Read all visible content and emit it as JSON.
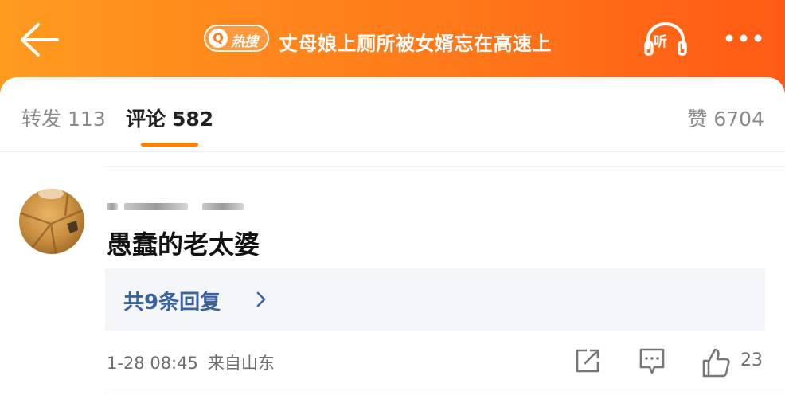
{
  "header": {
    "back_icon": "arrow-left-icon",
    "hot_badge_icon": "search-q-icon",
    "hot_badge_q": "Q",
    "hot_badge_label": "热搜",
    "title": "丈母娘上厕所被女婿忘在高速上",
    "listen_label": "听",
    "listen_icon": "headphones-icon",
    "more_icon": "more-dots-icon",
    "gradient": [
      "#ff9b1f",
      "#ff5a14"
    ]
  },
  "tabs": {
    "repost": {
      "label": "转发",
      "count": "113"
    },
    "comment": {
      "label": "评论",
      "count": "582",
      "active": true
    },
    "like": {
      "label": "赞",
      "count": "6704"
    },
    "accent_color": "#ff8200"
  },
  "comment": {
    "avatar_icon": "avatar-image",
    "text": "愚蠢的老太婆",
    "replies_label": "共9条回复",
    "replies_chevron_icon": "chevron-right-icon",
    "time": "1-28 08:45",
    "source": "来自山东",
    "share_icon": "share-icon",
    "reply_icon": "comment-icon",
    "like_icon": "thumb-up-icon",
    "like_count": "23",
    "link_color": "#3b62a0"
  }
}
